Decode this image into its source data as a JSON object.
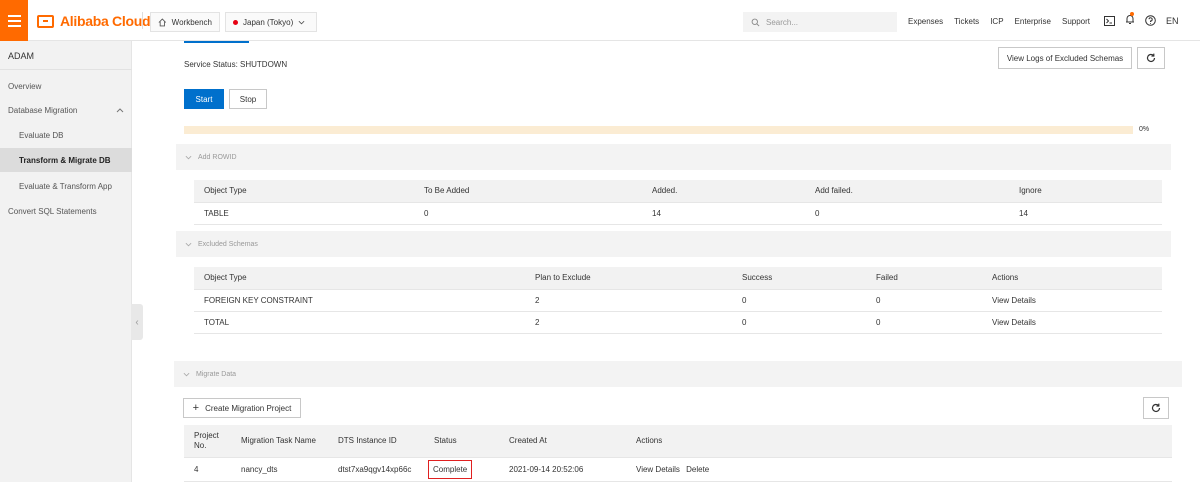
{
  "topbar": {
    "logo_text": "Alibaba Cloud",
    "workbench_label": "Workbench",
    "region_label": "Japan (Tokyo)",
    "search_placeholder": "Search...",
    "nav_links": [
      "Expenses",
      "Tickets",
      "ICP",
      "Enterprise",
      "Support"
    ],
    "lang": "EN"
  },
  "sidebar": {
    "title": "ADAM",
    "items": [
      {
        "label": "Overview"
      },
      {
        "label": "Database Migration"
      },
      {
        "label": "Evaluate DB"
      },
      {
        "label": "Transform & Migrate DB"
      },
      {
        "label": "Evaluate & Transform App"
      },
      {
        "label": "Convert SQL Statements"
      }
    ]
  },
  "main": {
    "service_status": "Service Status: SHUTDOWN",
    "view_logs_label": "View Logs of Excluded Schemas",
    "start_label": "Start",
    "stop_label": "Stop",
    "progress_percent": 0,
    "progress_label": "0%",
    "add_rowid": {
      "title": "Add ROWID",
      "headers": [
        "Object Type",
        "To Be Added",
        "Added.",
        "Add failed.",
        "Ignore"
      ],
      "rows": [
        [
          "TABLE",
          "0",
          "14",
          "0",
          "14"
        ]
      ]
    },
    "excluded_schemas": {
      "title": "Excluded Schemas",
      "headers": [
        "Object Type",
        "Plan to Exclude",
        "Success",
        "Failed",
        "Actions"
      ],
      "rows": [
        [
          "FOREIGN KEY CONSTRAINT",
          "2",
          "0",
          "0",
          "View Details"
        ],
        [
          "TOTAL",
          "2",
          "0",
          "0",
          "View Details"
        ]
      ]
    },
    "migrate_data": {
      "title": "Migrate Data",
      "create_label": "Create Migration Project",
      "headers": [
        "Project No.",
        "Migration Task Name",
        "DTS Instance ID",
        "Status",
        "Created At",
        "Actions"
      ],
      "rows": [
        {
          "no": "4",
          "name": "nancy_dts",
          "dts_id": "dtst7xa9qgv14xp66c",
          "status": "Complete",
          "created": "2021-09-14 20:52:06",
          "view": "View Details",
          "delete": "Delete"
        }
      ]
    }
  },
  "colors": {
    "brand": "#ff6a00",
    "primary": "#0070cc",
    "highlight": "#e02020"
  }
}
